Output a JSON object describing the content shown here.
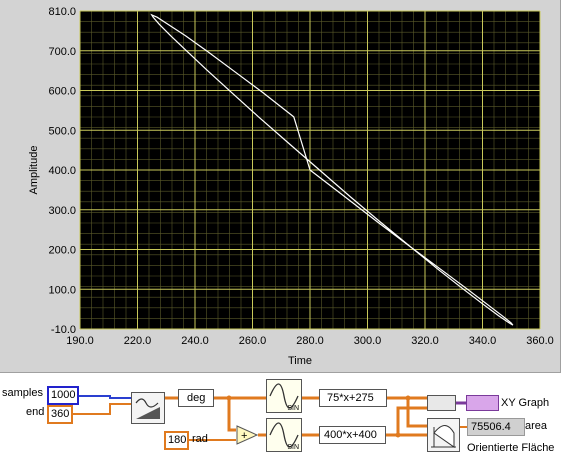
{
  "chart_data": {
    "type": "scatter",
    "mode": "line",
    "xlabel": "Time",
    "ylabel": "Amplitude",
    "xlim": [
      190.0,
      360.0
    ],
    "ylim": [
      -10.0,
      810.0
    ],
    "x_ticks": [
      "190.0",
      "220.0",
      "240.0",
      "260.0",
      "280.0",
      "300.0",
      "320.0",
      "340.0",
      "360.0"
    ],
    "y_ticks": [
      "-10.0",
      "100.0",
      "200.0",
      "300.0",
      "400.0",
      "500.0",
      "600.0",
      "700.0",
      "810.0"
    ],
    "grid": true,
    "background": "#000000",
    "grid_color": "#c8c85a",
    "line_color": "#ffffff",
    "series": [
      {
        "curve": "x = 75*sin(t)+275, y = 400*sin(t+180 deg)+400, t in 0..360 deg",
        "x": [
          275.0,
          288.0,
          300.5,
          312.5,
          323.5,
          333.0,
          340.5,
          346.0,
          349.3,
          350.0,
          348.5,
          344.7,
          339.0,
          331.5,
          322.5,
          312.5,
          301.5,
          290.0,
          278.5,
          267.0,
          256.0,
          246.0,
          237.0,
          229.5,
          223.5,
          219.3,
          217.0,
          216.5,
          218.5,
          222.5,
          229.0,
          237.0,
          246.5,
          257.5,
          269.0,
          275.0
        ],
        "y": [
          400.0,
          330.5,
          263.2,
          200.0,
          142.9,
          93.6,
          53.6,
          24.2,
          6.1,
          0.0,
          6.1,
          24.2,
          53.6,
          93.6,
          142.9,
          200.0,
          263.2,
          330.5,
          400.0,
          469.5,
          536.8,
          600.0,
          657.1,
          706.4,
          746.4,
          775.8,
          793.9,
          800.0,
          793.9,
          775.8,
          746.4,
          706.4,
          657.1,
          600.0,
          536.8,
          400.0
        ]
      }
    ]
  },
  "diagram": {
    "samples_label": "samples",
    "samples_value": "1000",
    "end_label": "end",
    "end_value": "360",
    "deg_node": "deg",
    "sin_label": "SIN",
    "formula_x": "75*x+275",
    "formula_y": "400*x+400",
    "const_value": "180",
    "rad_label": "rad",
    "xy_graph_label": "XY Graph",
    "area_value": "75506.4",
    "area_label": "area",
    "oriented_area_label": "Orientierte Fläche"
  }
}
